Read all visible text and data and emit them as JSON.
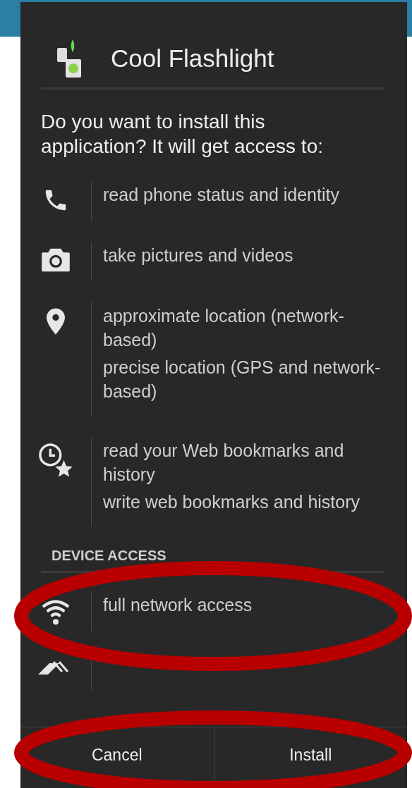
{
  "app": {
    "title": "Cool Flashlight"
  },
  "prompt": "Do you want to install this application? It will get access to:",
  "groups": [
    {
      "items": [
        {
          "kind": "phone",
          "lines": [
            "read phone status and identity"
          ]
        },
        {
          "kind": "camera",
          "lines": [
            "take pictures and videos"
          ]
        },
        {
          "kind": "location",
          "lines": [
            "approximate location (network-based)",
            "precise location (GPS and network-based)"
          ]
        },
        {
          "kind": "bookmark",
          "lines": [
            "read your Web bookmarks and history",
            "write web bookmarks and history"
          ]
        }
      ]
    },
    {
      "heading": "DEVICE ACCESS",
      "items": [
        {
          "kind": "wifi",
          "lines": [
            "full network access"
          ]
        },
        {
          "kind": "layers"
        }
      ]
    }
  ],
  "buttons": [
    "Cancel",
    "Install"
  ]
}
